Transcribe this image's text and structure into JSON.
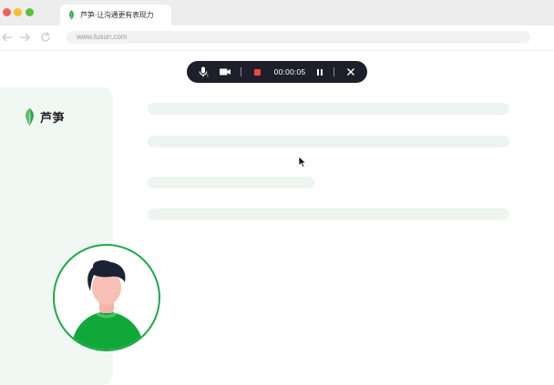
{
  "window": {
    "tab_title": "芦笋·让沟通更有表现力",
    "url": "www.lusun.com"
  },
  "nav": {
    "back_icon": "back-arrow-icon",
    "forward_icon": "forward-arrow-icon",
    "reload_icon": "reload-icon"
  },
  "recording_toolbar": {
    "timer": "00:00:05",
    "icons": [
      "microphone-icon",
      "camera-icon",
      "stop-icon",
      "pause-icon",
      "close-icon"
    ]
  },
  "sidebar": {
    "logo_text": "芦笋"
  },
  "colors": {
    "brand_green": "#1fa84a",
    "toolbar_bg": "#1f1f2c",
    "stop_red": "#f2463e",
    "sidebar_bg": "#f1f7f3"
  }
}
